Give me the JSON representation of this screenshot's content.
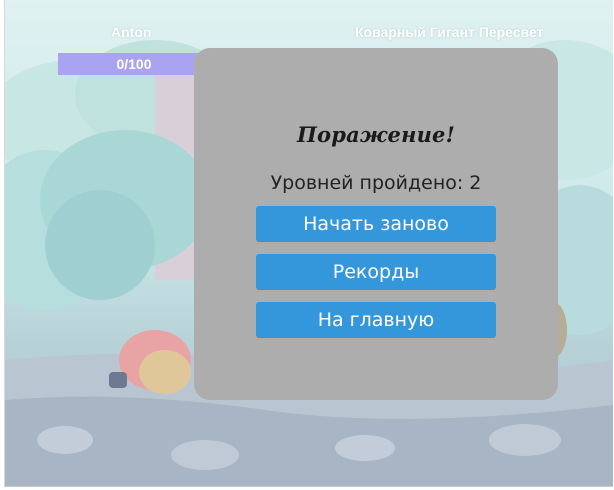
{
  "players": {
    "left_name": "Anton",
    "right_name": "Коварный Гигант Пересвет"
  },
  "health": {
    "text": "0/100",
    "fraction": 0
  },
  "dialog": {
    "title": "Поражение!",
    "levels_text": "Уровней пройдено: 2",
    "restart_label": "Начать заново",
    "records_label": "Рекорды",
    "home_label": "На главную"
  },
  "colors": {
    "button": "#3497db",
    "overlay": "#adadad",
    "health_bar": "#a9a3f2"
  }
}
